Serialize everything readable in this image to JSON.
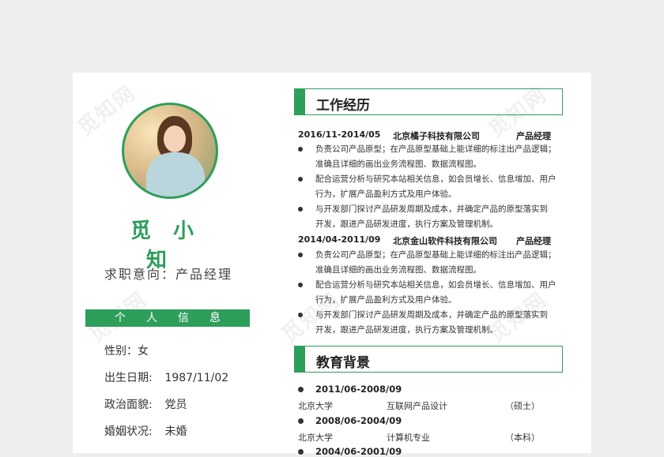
{
  "watermark": "觅知网",
  "profile": {
    "name": "觅小知",
    "intent": "求职意向：产品经理"
  },
  "personal": {
    "title": "个人信息",
    "rows": [
      {
        "label": "性别：女",
        "value": ""
      },
      {
        "label": "出生日期:",
        "value": "1987/11/02"
      },
      {
        "label": "政治面貌:",
        "value": "党员"
      },
      {
        "label": "婚姻状况:",
        "value": "未婚"
      }
    ]
  },
  "work": {
    "title": "工作经历",
    "jobs": [
      {
        "date": "2016/11-2014/05",
        "company": "北京橘子科技有限公司",
        "role": "产品经理",
        "bullets": [
          [
            "负责公司产品原型；在产品原型基础上能详细的标注出产品逻辑；",
            "准确且详细的画出业务流程图、数据流程图。"
          ],
          [
            "配合运营分析与研究本站相关信息，如会员增长、信息增加、用户",
            "行为，扩展产品盈利方式及用户体验。"
          ],
          [
            "与开发部门探讨产品研发周期及成本，并确定产品的原型落实到",
            "开发，跟进产品研发进度，执行方案及管理机制。"
          ]
        ]
      },
      {
        "date": "2014/04-2011/09",
        "company": "北京金山软件科技有限公司",
        "role": "产品经理",
        "bullets": [
          [
            "负责公司产品原型；在产品原型基础上能详细的标注出产品逻辑；",
            "准确且详细的画出业务流程图、数据流程图。"
          ],
          [
            "配合运营分析与研究本站相关信息，如会员增长、信息增加、用户",
            "行为，扩展产品盈利方式及用户体验。"
          ],
          [
            "与开发部门探讨产品研发周期及成本，并确定产品的原型落实到",
            "开发，跟进产品研发进度，执行方案及管理机制。"
          ]
        ]
      }
    ]
  },
  "education": {
    "title": "教育背景",
    "items": [
      {
        "date": "2011/06-2008/09",
        "school": "北京大学",
        "major": "互联网产品设计",
        "degree": "（硕士）"
      },
      {
        "date": "2008/06-2004/09",
        "school": "北京大学",
        "major": "计算机专业",
        "degree": "（本科）"
      },
      {
        "date": "2004/06-2001/09"
      }
    ]
  },
  "colors": {
    "accent": "#2e9e5b",
    "text": "#333333"
  }
}
